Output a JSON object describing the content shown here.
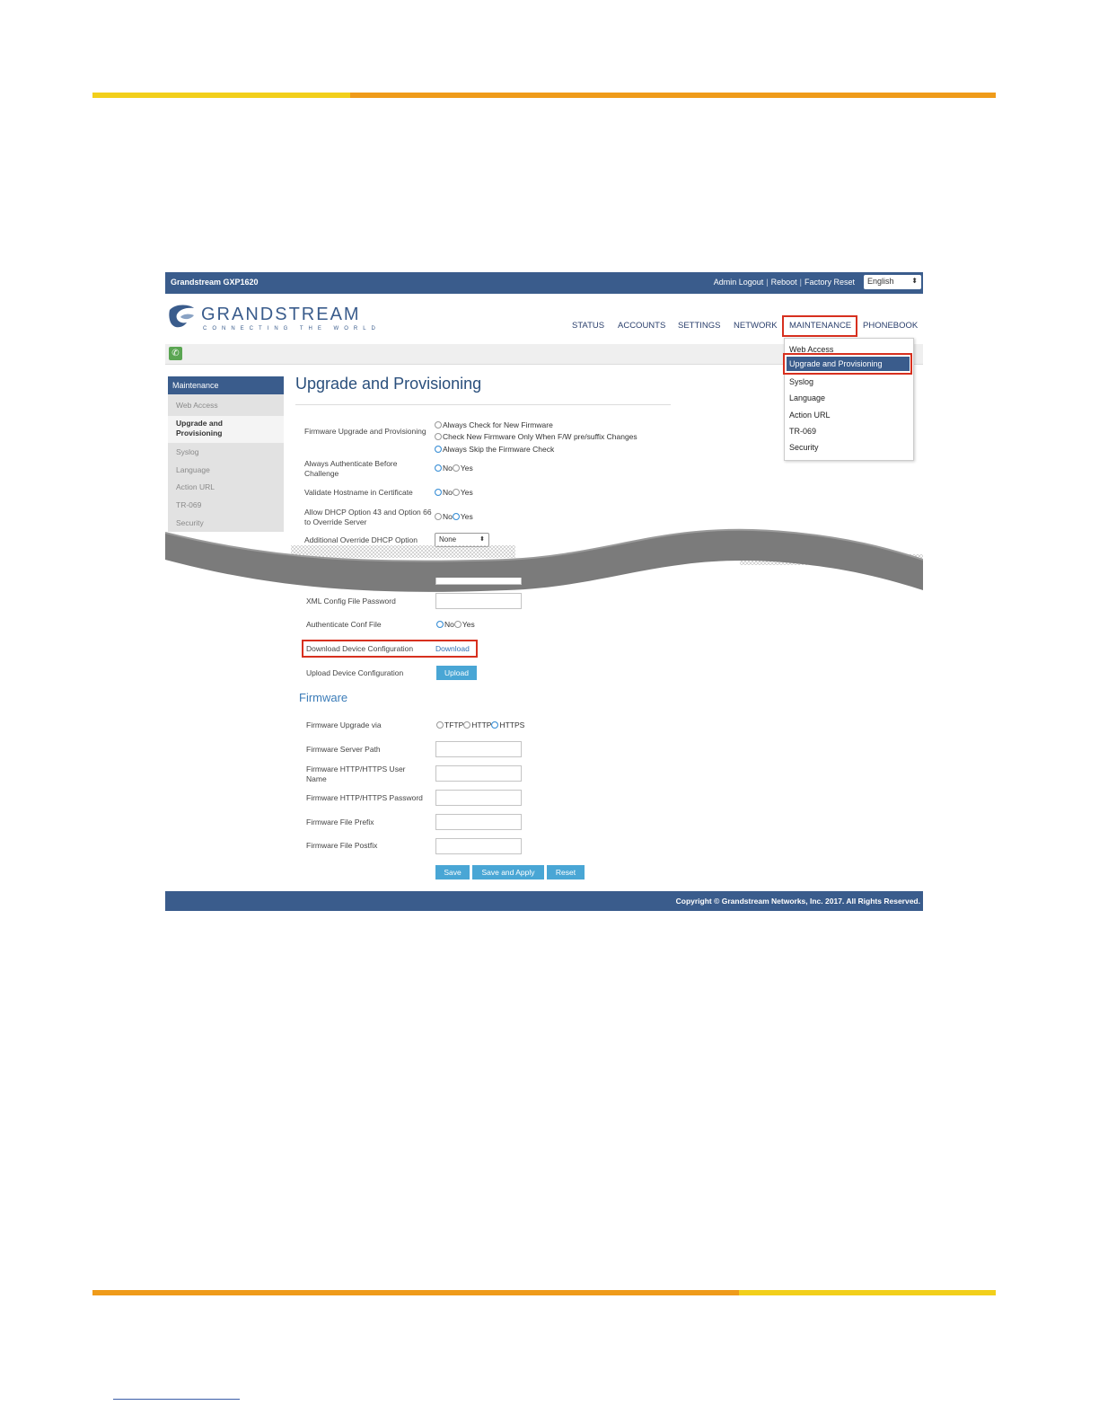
{
  "header": {
    "brand": "Grandstream GXP1620",
    "links": [
      "Admin Logout",
      "Reboot",
      "Factory Reset"
    ],
    "language": "English"
  },
  "logo": {
    "word": "GRANDSTREAM",
    "tagline": "CONNECTING THE WORLD"
  },
  "nav": {
    "items": [
      "STATUS",
      "ACCOUNTS",
      "SETTINGS",
      "NETWORK",
      "MAINTENANCE",
      "PHONEBOOK"
    ]
  },
  "dropdown": {
    "items": [
      "Web Access",
      "Upgrade and Provisioning",
      "Syslog",
      "Language",
      "Action URL",
      "TR-069",
      "Security"
    ]
  },
  "sidebar": {
    "heading": "Maintenance",
    "items": [
      "Web Access",
      "Upgrade and Provisioning",
      "Syslog",
      "Language",
      "Action URL",
      "TR-069",
      "Security"
    ]
  },
  "page": {
    "title": "Upgrade and Provisioning",
    "fw_upgrade_label": "Firmware Upgrade and Provisioning",
    "fw_upgrade_options": [
      "Always Check for New Firmware",
      "Check New Firmware Only When F/W pre/suffix Changes",
      "Always Skip the Firmware Check"
    ],
    "auth_challenge_label": "Always Authenticate Before Challenge",
    "validate_hostname_label": "Validate Hostname in Certificate",
    "dhcp_override_label": "Allow DHCP Option 43 and Option 66 to Override Server",
    "additional_dhcp_label": "Additional Override DHCP Option",
    "additional_dhcp_value": "None",
    "no": "No",
    "yes": "Yes",
    "xml_password_label": "XML Config File Password",
    "auth_conf_label": "Authenticate Conf File",
    "download_label": "Download Device Configuration",
    "download_link": "Download",
    "upload_label": "Upload Device Configuration",
    "upload_button": "Upload",
    "firmware_section": "Firmware",
    "fw_via_label": "Firmware Upgrade via",
    "fw_via_options": [
      "TFTP",
      "HTTP",
      "HTTPS"
    ],
    "fw_server_label": "Firmware Server Path",
    "fw_user_label": "Firmware HTTP/HTTPS User Name",
    "fw_password_label": "Firmware HTTP/HTTPS Password",
    "fw_prefix_label": "Firmware File Prefix",
    "fw_postfix_label": "Firmware File Postfix",
    "save": "Save",
    "save_apply": "Save and Apply",
    "reset": "Reset"
  },
  "footer": {
    "copyright": "Copyright © Grandstream Networks, Inc. 2017. All Rights Reserved."
  },
  "colors": {
    "header_blue": "#3a5c8c",
    "highlight_red": "#d7301f",
    "button_blue": "#49a6d5",
    "bar_yellow": "#f2cf1b",
    "bar_orange": "#ef9b1a"
  }
}
